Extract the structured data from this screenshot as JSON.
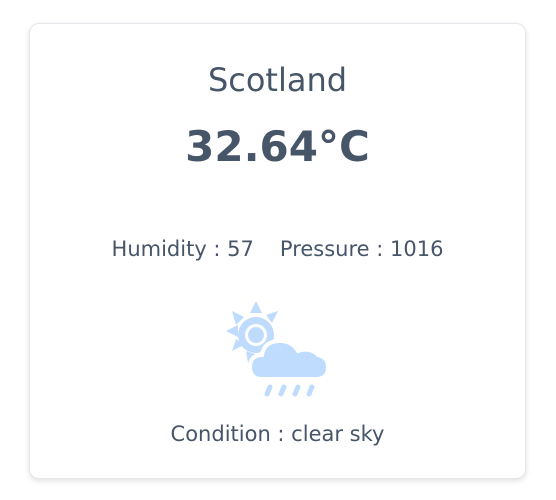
{
  "weather": {
    "city": "Scotland",
    "temperature": "32.64°C",
    "humidity_label": "Humidity : 57",
    "pressure_label": "Pressure : 1016",
    "condition_label": "Condition : clear sky",
    "icon": "sun-behind-rain-cloud-icon"
  },
  "colors": {
    "text": "#475569",
    "icon": "#bfdbfe",
    "card_border": "#e4e7eb"
  }
}
